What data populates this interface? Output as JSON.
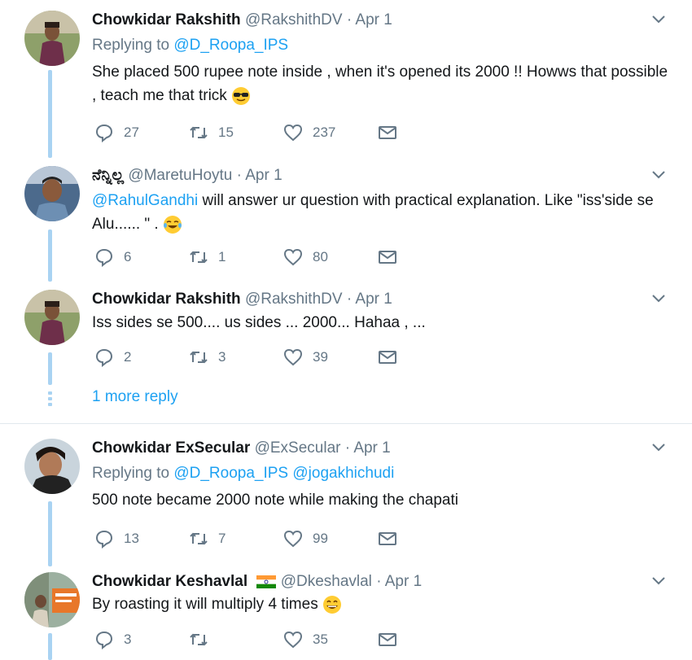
{
  "tweets": [
    {
      "name": "Chowkidar Rakshith",
      "handle": "@RakshithDV",
      "sep": "·",
      "date": "Apr 1",
      "replying_prefix": "Replying to ",
      "replying_to": [
        "@D_Roopa_IPS"
      ],
      "text": "She placed 500 rupee note inside , when it's opened its 2000 !! Howws that possible , teach me that trick",
      "emoji": "sunglasses-emoji",
      "replies": "27",
      "retweets": "15",
      "likes": "237"
    },
    {
      "name": "ನೆನ್ನಿಲ್ಲ",
      "handle": "@MaretuHoytu",
      "sep": "·",
      "date": "Apr 1",
      "mention": "@RahulGandhi",
      "text": " will answer ur question with practical explanation. Like \"iss'side se Alu...... \" .",
      "emoji": "tears-of-joy-emoji",
      "replies": "6",
      "retweets": "1",
      "likes": "80"
    },
    {
      "name": "Chowkidar Rakshith",
      "handle": "@RakshithDV",
      "sep": "·",
      "date": "Apr 1",
      "text": "Iss sides se 500.... us sides ... 2000... Hahaa , ...",
      "replies": "2",
      "retweets": "3",
      "likes": "39"
    },
    {
      "name": "Chowkidar ExSecular",
      "handle": "@ExSecular",
      "sep": "·",
      "date": "Apr 1",
      "replying_prefix": "Replying to ",
      "replying_to": [
        "@D_Roopa_IPS",
        "@jogakhichudi"
      ],
      "text": "500 note became 2000 note  while making the chapati",
      "replies": "13",
      "retweets": "7",
      "likes": "99"
    },
    {
      "name": "Chowkidar Keshavlal",
      "flag": "india-flag-emoji",
      "handle": "@Dkeshavlal",
      "sep": "·",
      "date": "Apr 1",
      "text": "By roasting it will multiply 4 times",
      "emoji": "grinning-emoji",
      "replies": "3",
      "retweets": "",
      "likes": "35"
    }
  ],
  "more_replies": "1 more reply",
  "colors": {
    "accent": "#1da1f2",
    "muted": "#657786",
    "thread": "#a9d3f2"
  }
}
